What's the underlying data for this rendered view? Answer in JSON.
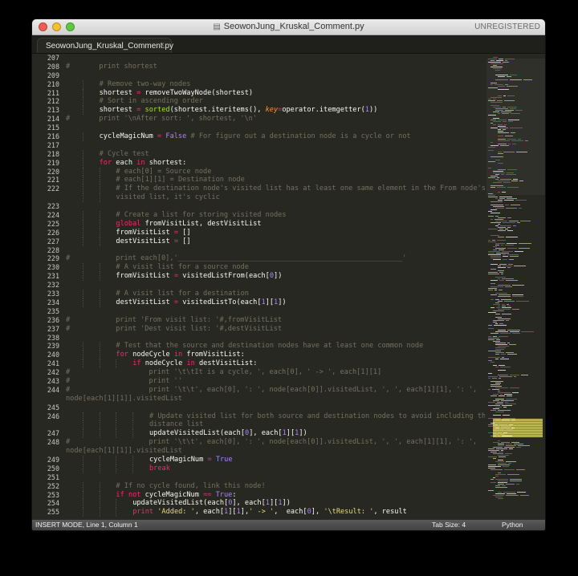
{
  "window": {
    "title": "SeowonJung_Kruskal_Comment.py",
    "license_text": "UNREGISTERED",
    "title_icon": "document-icon",
    "traffic_lights": {
      "close": "#ee5d50",
      "minimize": "#f5bf31",
      "zoom": "#5dc841"
    }
  },
  "tab": {
    "label": "SeowonJung_Kruskal_Comment.py",
    "close_glyph": "×"
  },
  "status": {
    "mode": "INSERT MODE, Line 1, Column 1",
    "tab_size": "Tab Size: 4",
    "language": "Python"
  },
  "theme": {
    "background": "#272822",
    "comment": "#75715e",
    "keyword": "#f92672",
    "function": "#a6e22e",
    "string": "#e6db74",
    "number": "#ae81ff",
    "argument": "#fd971f"
  },
  "lines": [
    {
      "n": "207",
      "i": 0,
      "t": []
    },
    {
      "n": "208",
      "i": 0,
      "t": [
        [
          "c",
          "#\t\tprint shortest"
        ]
      ]
    },
    {
      "n": "209",
      "i": 0,
      "t": []
    },
    {
      "n": "210",
      "i": 2,
      "t": [
        [
          "c",
          "# Remove two-way nodes"
        ]
      ]
    },
    {
      "n": "211",
      "i": 2,
      "t": [
        [
          "p",
          "shortest "
        ],
        [
          "k",
          "="
        ],
        [
          "p",
          " removeTwoWayNode(shortest)"
        ]
      ]
    },
    {
      "n": "212",
      "i": 2,
      "t": [
        [
          "c",
          "# Sort in ascending order"
        ]
      ]
    },
    {
      "n": "213",
      "i": 2,
      "t": [
        [
          "p",
          "shortest "
        ],
        [
          "k",
          "="
        ],
        [
          "p",
          " "
        ],
        [
          "f",
          "sorted"
        ],
        [
          "p",
          "(shortest.iteritems(), "
        ],
        [
          "a",
          "key"
        ],
        [
          "k",
          "="
        ],
        [
          "p",
          "operator.itemgetter("
        ],
        [
          "u",
          "1"
        ],
        [
          "p",
          "))"
        ]
      ]
    },
    {
      "n": "214",
      "i": 0,
      "t": [
        [
          "c",
          "#\t\tprint '\\nAfter sort: ', shortest, '\\n'"
        ]
      ]
    },
    {
      "n": "215",
      "i": 0,
      "t": []
    },
    {
      "n": "216",
      "i": 2,
      "t": [
        [
          "p",
          "cycleMagicNum "
        ],
        [
          "k",
          "="
        ],
        [
          "p",
          " "
        ],
        [
          "u",
          "False"
        ],
        [
          "p",
          " "
        ],
        [
          "c",
          "# For figure out a destination node is a cycle or not"
        ]
      ]
    },
    {
      "n": "217",
      "i": 0,
      "t": []
    },
    {
      "n": "218",
      "i": 2,
      "t": [
        [
          "c",
          "# Cycle test"
        ]
      ]
    },
    {
      "n": "219",
      "i": 2,
      "t": [
        [
          "k",
          "for"
        ],
        [
          "p",
          " each "
        ],
        [
          "k",
          "in"
        ],
        [
          "p",
          " shortest:"
        ]
      ]
    },
    {
      "n": "220",
      "i": 3,
      "t": [
        [
          "c",
          "# each[0] = Source node"
        ]
      ]
    },
    {
      "n": "221",
      "i": 3,
      "t": [
        [
          "c",
          "# each[1][1] = Destination node"
        ]
      ]
    },
    {
      "n": "222",
      "i": 3,
      "t": [
        [
          "c",
          "# If the destination node's visited list has at least one same element in the From node's"
        ]
      ]
    },
    {
      "n": "",
      "i": 3,
      "t": [
        [
          "c",
          "visited list, it's cyclic"
        ]
      ]
    },
    {
      "n": "223",
      "i": 0,
      "t": []
    },
    {
      "n": "224",
      "i": 3,
      "t": [
        [
          "c",
          "# Create a list for storing visited nodes"
        ]
      ]
    },
    {
      "n": "225",
      "i": 3,
      "t": [
        [
          "k",
          "global"
        ],
        [
          "p",
          " fromVisitList, destVisitList"
        ]
      ]
    },
    {
      "n": "226",
      "i": 3,
      "t": [
        [
          "p",
          "fromVisitList "
        ],
        [
          "k",
          "="
        ],
        [
          "p",
          " []"
        ]
      ]
    },
    {
      "n": "227",
      "i": 3,
      "t": [
        [
          "p",
          "destVisitList "
        ],
        [
          "k",
          "="
        ],
        [
          "p",
          " []"
        ]
      ]
    },
    {
      "n": "228",
      "i": 0,
      "t": []
    },
    {
      "n": "229",
      "i": 0,
      "t": [
        [
          "c",
          "#\t\t\tprint each[0],'______________________________________________________'"
        ]
      ]
    },
    {
      "n": "230",
      "i": 3,
      "t": [
        [
          "c",
          "# A visit list for a source node"
        ]
      ]
    },
    {
      "n": "231",
      "i": 3,
      "t": [
        [
          "p",
          "fromVisitList "
        ],
        [
          "k",
          "="
        ],
        [
          "p",
          " visitedListFrom(each["
        ],
        [
          "u",
          "0"
        ],
        [
          "p",
          "])"
        ]
      ]
    },
    {
      "n": "232",
      "i": 0,
      "t": []
    },
    {
      "n": "233",
      "i": 3,
      "t": [
        [
          "c",
          "# A visit list for a destination"
        ]
      ]
    },
    {
      "n": "234",
      "i": 3,
      "t": [
        [
          "p",
          "destVisitList "
        ],
        [
          "k",
          "="
        ],
        [
          "p",
          " visitedListTo(each["
        ],
        [
          "u",
          "1"
        ],
        [
          "p",
          "]["
        ],
        [
          "u",
          "1"
        ],
        [
          "p",
          "])"
        ]
      ]
    },
    {
      "n": "235",
      "i": 0,
      "t": []
    },
    {
      "n": "236",
      "i": 0,
      "t": [
        [
          "c",
          "#\t\t\tprint 'From visit list: '#,fromVisitList"
        ]
      ]
    },
    {
      "n": "237",
      "i": 0,
      "t": [
        [
          "c",
          "#\t\t\tprint 'Dest visit list: '#,destVisitList"
        ]
      ]
    },
    {
      "n": "238",
      "i": 0,
      "t": []
    },
    {
      "n": "239",
      "i": 3,
      "t": [
        [
          "c",
          "# Test that the source and destination nodes have at least one common node"
        ]
      ]
    },
    {
      "n": "240",
      "i": 3,
      "t": [
        [
          "k",
          "for"
        ],
        [
          "p",
          " nodeCycle "
        ],
        [
          "k",
          "in"
        ],
        [
          "p",
          " fromVisitList:"
        ]
      ]
    },
    {
      "n": "241",
      "i": 4,
      "t": [
        [
          "k",
          "if"
        ],
        [
          "p",
          " nodeCycle "
        ],
        [
          "k",
          "in"
        ],
        [
          "p",
          " destVisitList:"
        ]
      ]
    },
    {
      "n": "242",
      "i": 0,
      "t": [
        [
          "c",
          "#\t\t\t\t\tprint '\\t\\tIt is a cycle, ', each[0], ' -> ', each[1][1]"
        ]
      ]
    },
    {
      "n": "243",
      "i": 0,
      "t": [
        [
          "c",
          "#\t\t\t\t\tprint ''"
        ]
      ]
    },
    {
      "n": "244",
      "i": 0,
      "t": [
        [
          "c",
          "#\t\t\t\t\tprint '\\t\\t', each[0], ': ', node[each[0]].visitedList, ', ', each[1][1], ': ',"
        ]
      ]
    },
    {
      "n": "",
      "i": 0,
      "t": [
        [
          "c",
          "node[each[1][1]].visitedList"
        ]
      ]
    },
    {
      "n": "245",
      "i": 0,
      "t": []
    },
    {
      "n": "246",
      "i": 5,
      "t": [
        [
          "c",
          "# Update visited list for both source and destination nodes to avoid including the"
        ]
      ]
    },
    {
      "n": "",
      "i": 5,
      "t": [
        [
          "c",
          "distance list"
        ]
      ]
    },
    {
      "n": "247",
      "i": 5,
      "t": [
        [
          "p",
          "updateVisitedList(each["
        ],
        [
          "u",
          "0"
        ],
        [
          "p",
          "], each["
        ],
        [
          "u",
          "1"
        ],
        [
          "p",
          "]["
        ],
        [
          "u",
          "1"
        ],
        [
          "p",
          "])"
        ]
      ]
    },
    {
      "n": "248",
      "i": 0,
      "t": [
        [
          "c",
          "#\t\t\t\t\tprint '\\t\\t', each[0], ': ', node[each[0]].visitedList, ', ', each[1][1], ': ',"
        ]
      ]
    },
    {
      "n": "",
      "i": 0,
      "t": [
        [
          "c",
          "node[each[1][1]].visitedList"
        ]
      ]
    },
    {
      "n": "249",
      "i": 5,
      "t": [
        [
          "p",
          "cycleMagicNum "
        ],
        [
          "k",
          "="
        ],
        [
          "p",
          " "
        ],
        [
          "u",
          "True"
        ]
      ]
    },
    {
      "n": "250",
      "i": 5,
      "t": [
        [
          "k",
          "break"
        ]
      ]
    },
    {
      "n": "251",
      "i": 0,
      "t": []
    },
    {
      "n": "252",
      "i": 3,
      "t": [
        [
          "c",
          "# If no cycle found, link this node!"
        ]
      ]
    },
    {
      "n": "253",
      "i": 3,
      "t": [
        [
          "k",
          "if"
        ],
        [
          "p",
          " "
        ],
        [
          "k",
          "not"
        ],
        [
          "p",
          " cycleMagicNum "
        ],
        [
          "k",
          "=="
        ],
        [
          "p",
          " "
        ],
        [
          "u",
          "True"
        ],
        [
          "p",
          ":"
        ]
      ]
    },
    {
      "n": "254",
      "i": 4,
      "t": [
        [
          "p",
          "updateVisitedList(each["
        ],
        [
          "u",
          "0"
        ],
        [
          "p",
          "], each["
        ],
        [
          "u",
          "1"
        ],
        [
          "p",
          "]["
        ],
        [
          "u",
          "1"
        ],
        [
          "p",
          "])"
        ]
      ]
    },
    {
      "n": "255",
      "i": 4,
      "t": [
        [
          "k",
          "print"
        ],
        [
          "p",
          " "
        ],
        [
          "s",
          "'Added: '"
        ],
        [
          "p",
          ", each["
        ],
        [
          "u",
          "1"
        ],
        [
          "p",
          "]["
        ],
        [
          "u",
          "1"
        ],
        [
          "p",
          "],"
        ],
        [
          "s",
          "' -> '"
        ],
        [
          "p",
          ",  each["
        ],
        [
          "u",
          "0"
        ],
        [
          "p",
          "], "
        ],
        [
          "s",
          "'\\tResult: '"
        ],
        [
          "p",
          ", result"
        ]
      ]
    }
  ]
}
